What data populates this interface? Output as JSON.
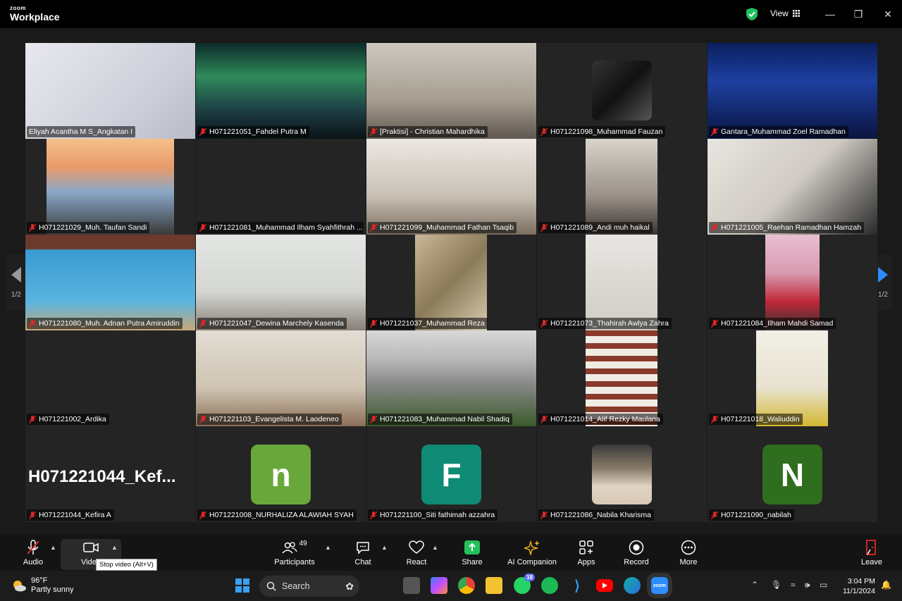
{
  "app": {
    "brand_top": "zoom",
    "brand_bottom": "Workplace",
    "view_label": "View"
  },
  "pagination": {
    "indicator": "1/2"
  },
  "colors": {
    "active_outline": "#3ee17a",
    "avatar_n_lower": "#6aa73a",
    "avatar_F": "#0f8a75",
    "avatar_N": "#2f6d1f"
  },
  "participants": [
    {
      "name": "Eliyah Acantha M S_Angkatan I",
      "muted": false,
      "active": true
    },
    {
      "name": "H071221051_Fahdel Putra M",
      "muted": true
    },
    {
      "name": "[Praktisi] - Christian Mahardhika",
      "muted": true
    },
    {
      "name": "H071221098_Muhammad Fauzan",
      "muted": true
    },
    {
      "name": "Gantara_Muhammad Zoel Ramadhan",
      "muted": true
    },
    {
      "name": "H071221029_Muh. Taufan Sandi",
      "muted": true
    },
    {
      "name": "H071221081_Muhammad Ilham Syahfithrah ...",
      "muted": true
    },
    {
      "name": "H071221099_Muhammad Fathan Tsaqib",
      "muted": true
    },
    {
      "name": "H071221089_Andi muh haikal",
      "muted": true
    },
    {
      "name": "H071221005_Raehan Ramadhan Hamzah",
      "muted": true
    },
    {
      "name": "H071221080_Muh. Adnan Putra Amiruddin",
      "muted": true
    },
    {
      "name": "H071221047_Dewina Marchely Kasenda",
      "muted": true
    },
    {
      "name": "H071221037_Muhammad Reza",
      "muted": true
    },
    {
      "name": "H071221073_Thahirah Awlya Zahra",
      "muted": true
    },
    {
      "name": "H071221084_Ilham Mahdi Samad",
      "muted": true
    },
    {
      "name": "H071221002_Ardika",
      "muted": true
    },
    {
      "name": "H071221103_Evangelista M. Laodeneo",
      "muted": true
    },
    {
      "name": "H071221083_Muhammad Nabil Shadiq",
      "muted": true
    },
    {
      "name": "H071221014_Alif Rezky Maulana",
      "muted": true
    },
    {
      "name": "H071221018_Waliuddin",
      "muted": true
    },
    {
      "name": "H071221044_Kefira A",
      "muted": true,
      "big_name": "H071221044_Kef..."
    },
    {
      "name": "H071221008_NURHALIZA ALAWIAH SYAH",
      "muted": true,
      "avatar_letter": "n"
    },
    {
      "name": "H071221100_Siti fathimah azzahra",
      "muted": true,
      "avatar_letter": "F"
    },
    {
      "name": "H071221086_Nabila Kharisma",
      "muted": true
    },
    {
      "name": "H071221090_nabilah",
      "muted": true,
      "avatar_letter": "N"
    }
  ],
  "toolbar": {
    "audio": "Audio",
    "video": "Video",
    "tooltip": "Stop video (Alt+V)",
    "participants": "Participants",
    "participants_count": "49",
    "chat": "Chat",
    "react": "React",
    "share": "Share",
    "ai": "AI Companion",
    "apps": "Apps",
    "record": "Record",
    "more": "More",
    "leave": "Leave"
  },
  "taskbar": {
    "weather_temp": "96°F",
    "weather_desc": "Partly sunny",
    "search": "Search",
    "whatsapp_badge": "18",
    "time": "3:04 PM",
    "date": "11/1/2024"
  }
}
